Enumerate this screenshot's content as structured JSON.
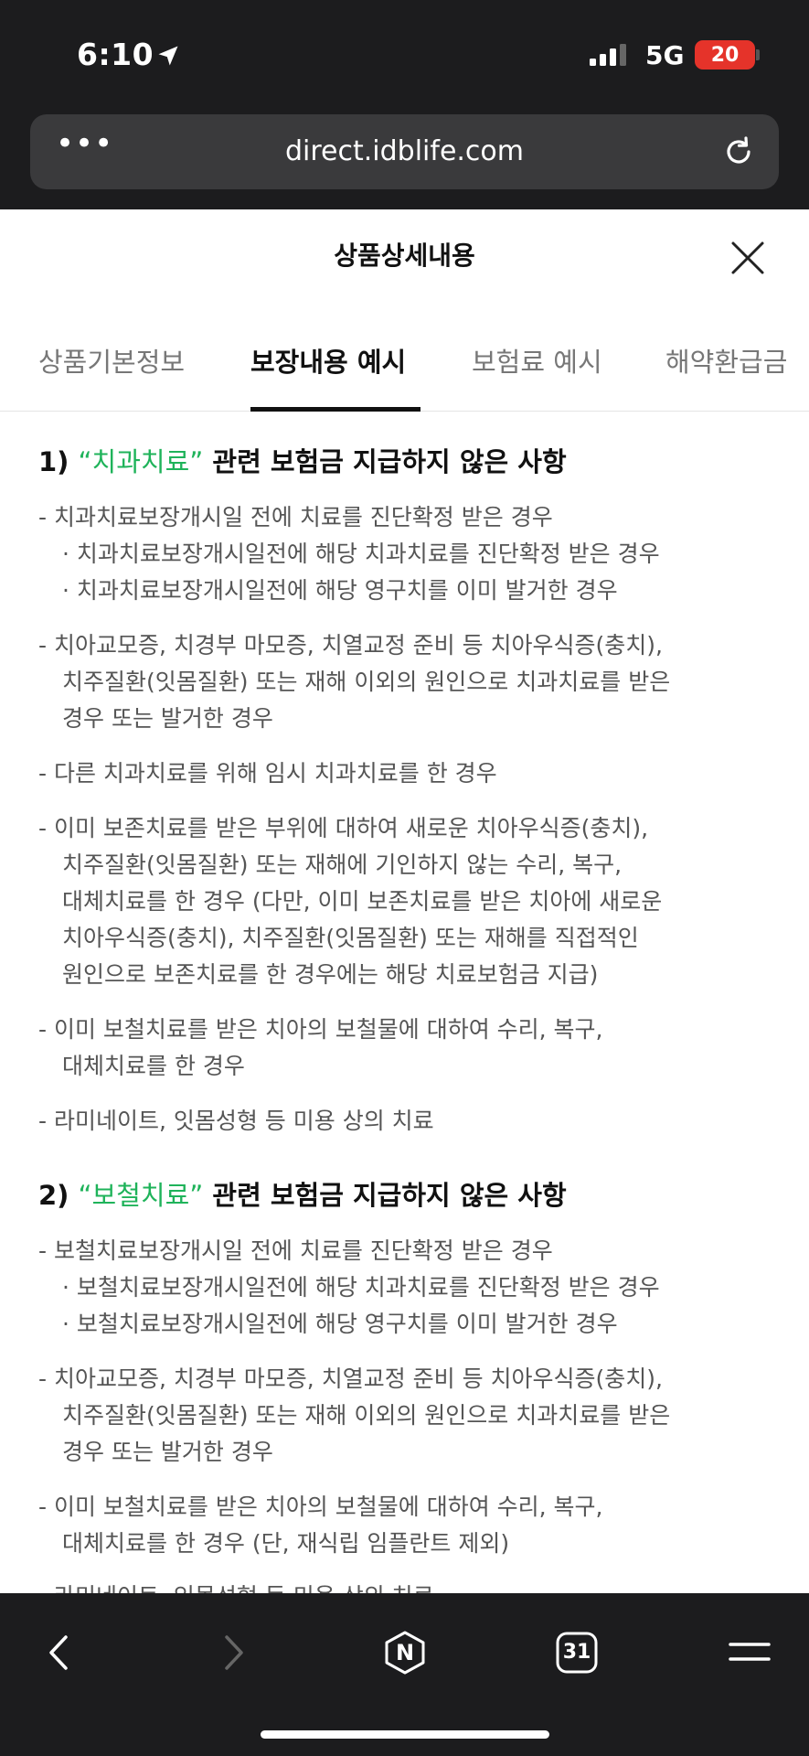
{
  "status": {
    "time": "6:10",
    "network": "5G",
    "battery": "20"
  },
  "browser": {
    "url": "direct.idblife.com",
    "more": "•••"
  },
  "modal": {
    "title": "상품상세내용"
  },
  "tabs": [
    {
      "label": "상품기본정보"
    },
    {
      "label": "보장내용 예시"
    },
    {
      "label": "보험료 예시"
    },
    {
      "label": "해약환급금"
    }
  ],
  "sections": [
    {
      "num": "1) ",
      "term": "“치과치료”",
      "rest": " 관련 보험금 지급하지 않은 사항",
      "lines": [
        "- 치과치료보장개시일 전에 치료를 진단확정 받은 경우",
        "· 치과치료보장개시일전에 해당 치과치료를 진단확정 받은 경우",
        "· 치과치료보장개시일전에 해당 영구치를 이미 발거한 경우",
        "- 치아교모증, 치경부 마모증, 치열교정 준비 등 치아우식증(충치),",
        "치주질환(잇몸질환) 또는 재해 이외의 원인으로 치과치료를 받은",
        "경우 또는 발거한 경우",
        "- 다른 치과치료를 위해 임시 치과치료를 한 경우",
        "- 이미 보존치료를 받은 부위에 대하여 새로운 치아우식증(충치),",
        "치주질환(잇몸질환) 또는 재해에 기인하지 않는 수리, 복구,",
        "대체치료를 한 경우 (다만, 이미 보존치료를 받은 치아에 새로운",
        "치아우식증(충치), 치주질환(잇몸질환) 또는 재해를 직접적인",
        "원인으로 보존치료를 한 경우에는 해당 치료보험금 지급)",
        "- 이미 보철치료를 받은 치아의 보철물에 대하여 수리, 복구,",
        "대체치료를 한 경우",
        "- 라미네이트, 잇몸성형 등 미용 상의 치료"
      ]
    },
    {
      "num": "2) ",
      "term": "“보철치료”",
      "rest": " 관련 보험금 지급하지 않은 사항",
      "lines": [
        "- 보철치료보장개시일 전에 치료를 진단확정 받은 경우",
        "· 보철치료보장개시일전에 해당 치과치료를 진단확정 받은 경우",
        "· 보철치료보장개시일전에 해당 영구치를 이미 발거한 경우",
        "- 치아교모증, 치경부 마모증, 치열교정 준비 등 치아우식증(충치),",
        "치주질환(잇몸질환) 또는 재해 이외의 원인으로 치과치료를 받은",
        "경우 또는 발거한 경우",
        "- 이미 보철치료를 받은 치아의 보철물에 대하여 수리, 복구,",
        "대체치료를 한 경우 (단, 재식립 임플란트 제외)",
        "- 라미네이트, 잇몸성형 등 미용 상의 치료"
      ]
    }
  ],
  "toolbar": {
    "tabs_count": "31",
    "naver": "N"
  }
}
